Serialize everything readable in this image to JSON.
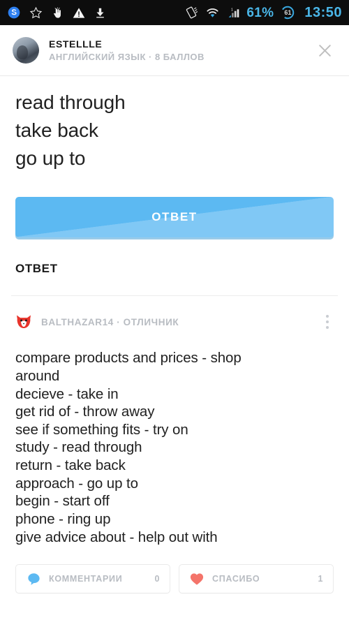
{
  "status_bar": {
    "battery_percent": "61%",
    "battery_ring_label": "61",
    "clock": "13:50",
    "accent_color": "#4ab6e8",
    "background_color": "#0d0d0d",
    "left_icons": [
      "skype-icon",
      "star-icon",
      "hand-touch-icon",
      "warning-triangle-icon",
      "download-icon"
    ],
    "right_icons": [
      "screen-rotate-icon",
      "wifi-icon",
      "signal-bars-icon",
      "battery-ring-icon"
    ]
  },
  "question_header": {
    "author": "ESTELLLE",
    "subtitle": "АНГЛИЙСКИЙ ЯЗЫК · 8 БАЛЛОВ",
    "close_icon": "close-icon",
    "avatar_icon": "avatar"
  },
  "question": {
    "text": "read through\ntake back\ngo up to"
  },
  "answer_button": {
    "label": "ОТВЕТ",
    "color": "#5cb9f2",
    "text_color": "#ffffff"
  },
  "answer_section": {
    "title": "ОТВЕТ",
    "author": "BALTHAZAR14 · ОТЛИЧНИК",
    "badge_icon": "red-cat-avatar-icon",
    "menu_icon": "kebab-menu-icon",
    "body": "compare products and prices - shop\naround\ndecieve - take in\nget rid of - throw away\nsee if something fits - try on\nstudy - read through\nreturn - take back\napproach - go up to\nbegin - start off\nphone - ring up\ngive advice about - help out with"
  },
  "actions": {
    "comments": {
      "label": "КОММЕНТАРИИ",
      "count": "0",
      "icon": "speech-bubble-icon",
      "icon_color": "#5cb9f2"
    },
    "thanks": {
      "label": "СПАСИБО",
      "count": "1",
      "icon": "heart-icon",
      "icon_color": "#f4746a"
    }
  }
}
